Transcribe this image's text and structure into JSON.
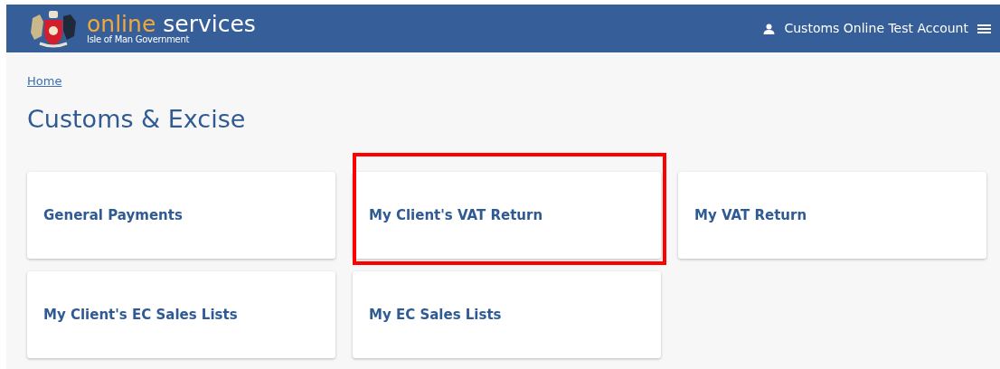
{
  "header": {
    "logo_title_a": "online",
    "logo_title_b": "services",
    "logo_subtitle": "Isle of Man Government",
    "account": "Customs Online Test Account"
  },
  "breadcrumb": [
    "Home"
  ],
  "title": "Customs & Excise",
  "cards": [
    {
      "label": "General Payments",
      "highlighted": false
    },
    {
      "label": "My Client's VAT Return",
      "highlighted": true
    },
    {
      "label": "My VAT Return",
      "highlighted": false
    },
    {
      "label": "My Client's EC Sales Lists",
      "highlighted": false
    },
    {
      "label": "My EC Sales Lists",
      "highlighted": false
    }
  ]
}
